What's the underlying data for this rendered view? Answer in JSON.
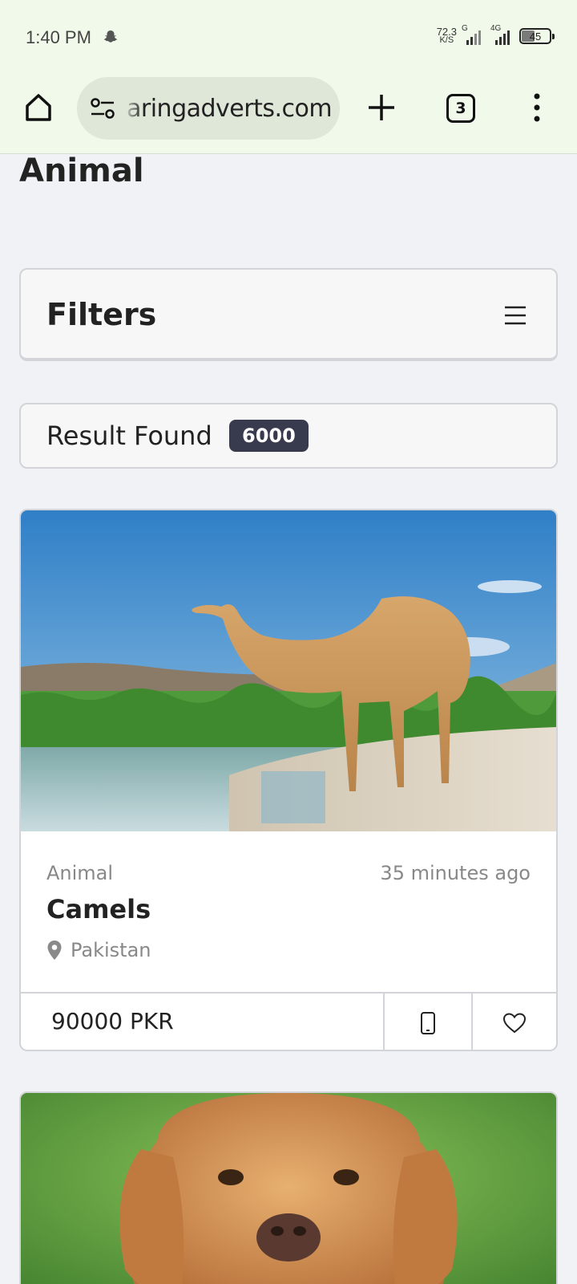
{
  "status_bar": {
    "time": "1:40 PM",
    "net_speed_value": "72.3",
    "net_speed_unit": "K/S",
    "sim1_label": "G",
    "sim2_label": "4G",
    "battery": "45"
  },
  "browser": {
    "url": "aringadverts.com",
    "tab_count": "3"
  },
  "page": {
    "heading": "Animal",
    "filters_title": "Filters",
    "result_label": "Result Found",
    "result_count": "6000"
  },
  "listings": [
    {
      "category": "Animal",
      "posted": "35 minutes ago",
      "title": "Camels",
      "location": "Pakistan",
      "price": "90000 PKR"
    }
  ],
  "colors": {
    "browser_bg": "#f1faea",
    "url_bar_bg": "#dfe7d9",
    "page_bg": "#f1f2f6",
    "badge_bg": "#383a4d"
  }
}
